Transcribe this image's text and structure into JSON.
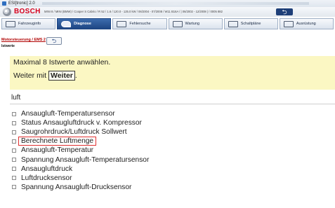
{
  "window": {
    "title": "ESI[tronic] 2.0",
    "icon": "app-icon"
  },
  "brand": {
    "name": "BOSCH",
    "vehicle": "MINI 8 / MINI (BMW) / Cooper S Cabrio / R 52 / 1.6 / 120.0 - 125.0 kW / 06/2004 - 07/2008 / W11 B16A / | 06/2002 - 12/2008 | / 0005 882",
    "back_icon": "back-arrow-icon"
  },
  "tabs": [
    {
      "label": "Fahrzeuginfo",
      "icon": "car-icon",
      "active": false
    },
    {
      "label": "Diagnose",
      "icon": "diagnosis-icon",
      "active": true
    },
    {
      "label": "Fehlersuche",
      "icon": "troubleshooting-icon",
      "active": false
    },
    {
      "label": "Wartung",
      "icon": "maintenance-icon",
      "active": false
    },
    {
      "label": "Schaltpläne",
      "icon": "wiring-diagram-icon",
      "active": false
    },
    {
      "label": "Ausrüstung",
      "icon": "equipment-icon",
      "active": false
    }
  ],
  "breadcrumb": {
    "path": "Motorsteuerung / EMS 2",
    "subtitle": "Istwerte",
    "back_icon": "back-arrow-icon"
  },
  "message": {
    "line1": "Maximal 8 Istwerte anwählen.",
    "line2_prefix": "Weiter mit ",
    "button_label": "Weiter",
    "line2_suffix": "."
  },
  "search": {
    "value": "luft"
  },
  "results": [
    {
      "label": "Ansaugluft-Temperatursensor",
      "highlighted": false
    },
    {
      "label": "Status Ansaugluftdruck v. Kompressor",
      "highlighted": false
    },
    {
      "label": "Saugrohrdruck/Luftdruck Sollwert",
      "highlighted": false
    },
    {
      "label": "Berechnete Luftmenge",
      "highlighted": true
    },
    {
      "label": "Ansaugluft-Temperatur",
      "highlighted": false
    },
    {
      "label": "Spannung Ansaugluft-Temperatursensor",
      "highlighted": false
    },
    {
      "label": "Ansaugluftdruck",
      "highlighted": false
    },
    {
      "label": "Luftdrucksensor",
      "highlighted": false
    },
    {
      "label": "Spannung Ansaugluft-Drucksensor",
      "highlighted": false
    }
  ],
  "colors": {
    "brand_red": "#d6001c",
    "active_tab": "#1e4683",
    "message_bg": "#fbf7c3",
    "highlight_border": "#e03030"
  }
}
